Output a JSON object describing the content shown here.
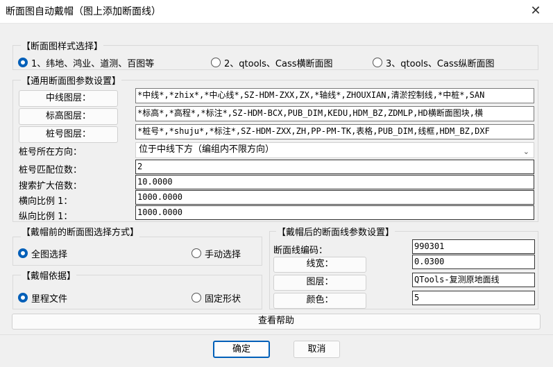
{
  "window": {
    "title": "断面图自动戴帽（图上添加断面线）",
    "close_glyph": "✕"
  },
  "style_group": {
    "legend": "【断面图样式选择】",
    "options": [
      {
        "label": "1、纬地、鸿业、道测、百图等",
        "selected": true
      },
      {
        "label": "2、qtools、Cass横断面图",
        "selected": false
      },
      {
        "label": "3、qtools、Cass纵断面图",
        "selected": false
      }
    ]
  },
  "params_group": {
    "legend": "【通用断面图参数设置】",
    "center_layer": {
      "button": "中线图层：",
      "value": "*中线*,*zhix*,*中心线*,SZ-HDM-ZXX,ZX,*轴线*,ZHOUXIAN,清淤控制线,*中桩*,SAN"
    },
    "elev_layer": {
      "button": "标高图层：",
      "value": "*标高*,*高程*,*标注*,SZ-HDM-BCX,PUB_DIM,KEDU,HDM_BZ,ZDMLP,HD横断面图块,横"
    },
    "pile_layer": {
      "button": "桩号图层：",
      "value": "*桩号*,*shuju*,*标注*,SZ-HDM-ZXX,ZH,PP-PM-TK,表格,PUB_DIM,线框,HDM_BZ,DXF"
    },
    "direction": {
      "label": "桩号所在方向：",
      "value": "位于中线下方（编组内不限方向）"
    },
    "match_digits": {
      "label": "桩号匹配位数：",
      "value": "2"
    },
    "search_factor": {
      "label": "搜索扩大倍数：",
      "value": "10.0000"
    },
    "h_scale": {
      "label": "横向比例 1：",
      "value": "1000.0000"
    },
    "v_scale": {
      "label": "纵向比例 1：",
      "value": "1000.0000"
    }
  },
  "select_group": {
    "legend": "【戴帽前的断面图选择方式】",
    "options": [
      {
        "label": "全图选择",
        "selected": true
      },
      {
        "label": "手动选择",
        "selected": false
      }
    ]
  },
  "basis_group": {
    "legend": "【戴帽依据】",
    "options": [
      {
        "label": "里程文件",
        "selected": true
      },
      {
        "label": "固定形状",
        "selected": false
      }
    ]
  },
  "line_group": {
    "legend": "【戴帽后的断面线参数设置】",
    "code": {
      "label": "断面线编码：",
      "value": "990301"
    },
    "width": {
      "button": "线宽：",
      "value": "0.0300"
    },
    "layer": {
      "button": "图层：",
      "value": "QTools-复测原地面线"
    },
    "color": {
      "button": "颜色：",
      "value": "5"
    }
  },
  "help_button": "查看帮助",
  "ok_button": "确定",
  "cancel_button": "取消",
  "colors": {
    "accent": "#005fb8",
    "background": "#f0f0f0"
  }
}
